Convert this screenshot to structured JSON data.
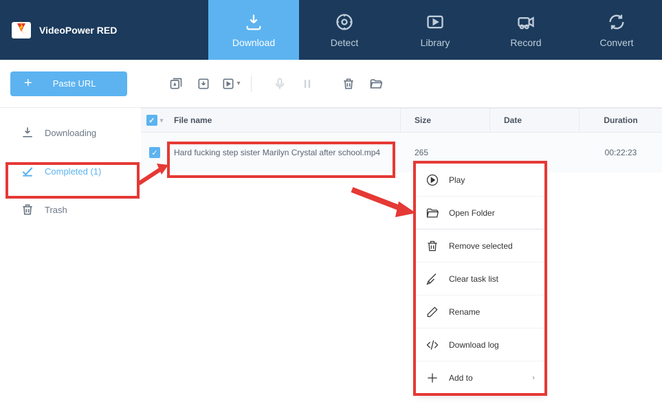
{
  "app": {
    "title": "VideoPower RED"
  },
  "nav": {
    "download": "Download",
    "detect": "Detect",
    "library": "Library",
    "record": "Record",
    "convert": "Convert"
  },
  "toolbar": {
    "paste_url": "Paste URL"
  },
  "sidebar": {
    "downloading": "Downloading",
    "completed": "Completed (1)",
    "trash": "Trash"
  },
  "table": {
    "headers": {
      "filename": "File name",
      "size": "Size",
      "date": "Date",
      "duration": "Duration"
    },
    "rows": [
      {
        "filename": "Hard fucking step sister Marilyn Crystal after school.mp4",
        "size": "265",
        "date": "",
        "duration": "00:22:23"
      }
    ]
  },
  "context_menu": {
    "play": "Play",
    "open_folder": "Open Folder",
    "remove_selected": "Remove selected",
    "clear_task_list": "Clear task list",
    "rename": "Rename",
    "download_log": "Download log",
    "add_to": "Add to"
  }
}
